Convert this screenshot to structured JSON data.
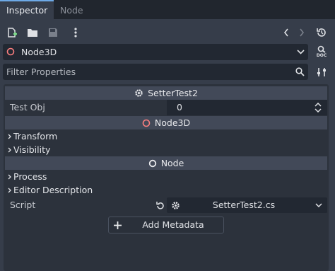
{
  "tabs": [
    {
      "label": "Inspector",
      "active": true
    },
    {
      "label": "Node",
      "active": false
    }
  ],
  "toolbar": {
    "icons": [
      "new-resource-icon",
      "open-folder-icon",
      "save-icon",
      "more-vertical-icon",
      "history-back-icon",
      "history-forward-icon",
      "object-history-icon"
    ]
  },
  "node_selector": {
    "value": "Node3D",
    "doc_label": "DOC"
  },
  "filter": {
    "placeholder": "Filter Properties"
  },
  "inspector": {
    "script_category": "SetterTest2",
    "test_obj": {
      "label": "Test Obj",
      "value": "0"
    },
    "node3d_category": "Node3D",
    "node3d_sections": [
      "Transform",
      "Visibility"
    ],
    "node_category": "Node",
    "node_sections": [
      "Process",
      "Editor Description"
    ],
    "script": {
      "label": "Script",
      "value": "SetterTest2.cs"
    },
    "add_metadata_label": "Add Metadata"
  },
  "colors": {
    "accent": "#6da9e6",
    "node3d_icon": "#fc7f7f",
    "background": "#363d4a",
    "field": "#222832"
  }
}
